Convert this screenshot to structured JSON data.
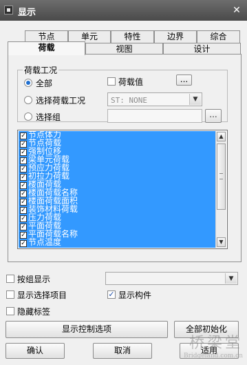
{
  "window": {
    "title": "显示",
    "close_glyph": "✕",
    "icon": "window-app-icon"
  },
  "tabs_row1": [
    "节点",
    "单元",
    "特性",
    "边界",
    "综合"
  ],
  "tabs_row2": [
    "荷载",
    "视图",
    "设计"
  ],
  "active_tab": "荷载",
  "load_case_group": {
    "title": "荷载工况",
    "radio_all": "全部",
    "radio_select_case": "选择荷载工况",
    "radio_select_group": "选择组",
    "selected": "全部",
    "load_value_checkbox": {
      "label": "荷载值",
      "checked": false
    },
    "ellipsis": "...",
    "case_combo_value": "ST: NONE",
    "group_ellipsis": "..."
  },
  "load_items": [
    {
      "label": "节点体力",
      "checked": true
    },
    {
      "label": "节点荷载",
      "checked": true
    },
    {
      "label": "强制位移",
      "checked": true
    },
    {
      "label": "梁单元荷载",
      "checked": true
    },
    {
      "label": "预应力荷载",
      "checked": true
    },
    {
      "label": "初拉力荷载",
      "checked": true
    },
    {
      "label": "楼面荷载",
      "checked": true
    },
    {
      "label": "楼面荷载名称",
      "checked": true
    },
    {
      "label": "楼面荷载面积",
      "checked": true
    },
    {
      "label": "装饰材料荷载",
      "checked": true
    },
    {
      "label": "压力荷载",
      "checked": true
    },
    {
      "label": "平面荷载",
      "checked": true
    },
    {
      "label": "平面荷载名称",
      "checked": true
    },
    {
      "label": "节点温度",
      "checked": true
    }
  ],
  "bottom": {
    "by_group": {
      "label": "按组显示",
      "checked": false
    },
    "show_selected": {
      "label": "显示选择项目",
      "checked": false
    },
    "show_members": {
      "label": "显示构件",
      "checked": true
    },
    "hide_labels": {
      "label": "隐藏标签",
      "checked": false
    },
    "display_control_button": "显示控制选项",
    "reset_all_button": "全部初始化",
    "ok_button": "确认",
    "cancel_button": "取消",
    "apply_button": "适用"
  },
  "watermark": {
    "line1": "桥梁堂",
    "line2": "Bridgeland.com.cn"
  },
  "colors": {
    "selection": "#3399ff",
    "titlebar": "#4a4a4a",
    "radio_dot": "#1f6fd0"
  }
}
